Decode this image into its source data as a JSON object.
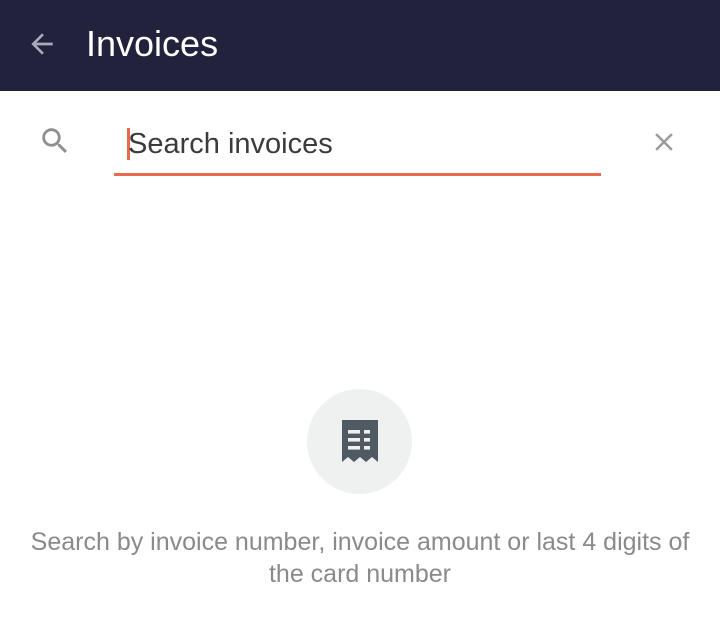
{
  "header": {
    "title": "Invoices",
    "back_icon": "arrow-left-icon"
  },
  "search": {
    "icon": "search-icon",
    "placeholder": "Search invoices",
    "value": "",
    "clear_icon": "close-icon"
  },
  "empty_state": {
    "icon": "receipt-icon",
    "hint_line1": "Search by invoice number, invoice amount or last 4 digits of",
    "hint_line2": "the card number"
  },
  "colors": {
    "app_bar": "#22223d",
    "accent": "#e8694d",
    "hint_text": "#8a8a8a",
    "icon_circle": "#eff0f0"
  }
}
